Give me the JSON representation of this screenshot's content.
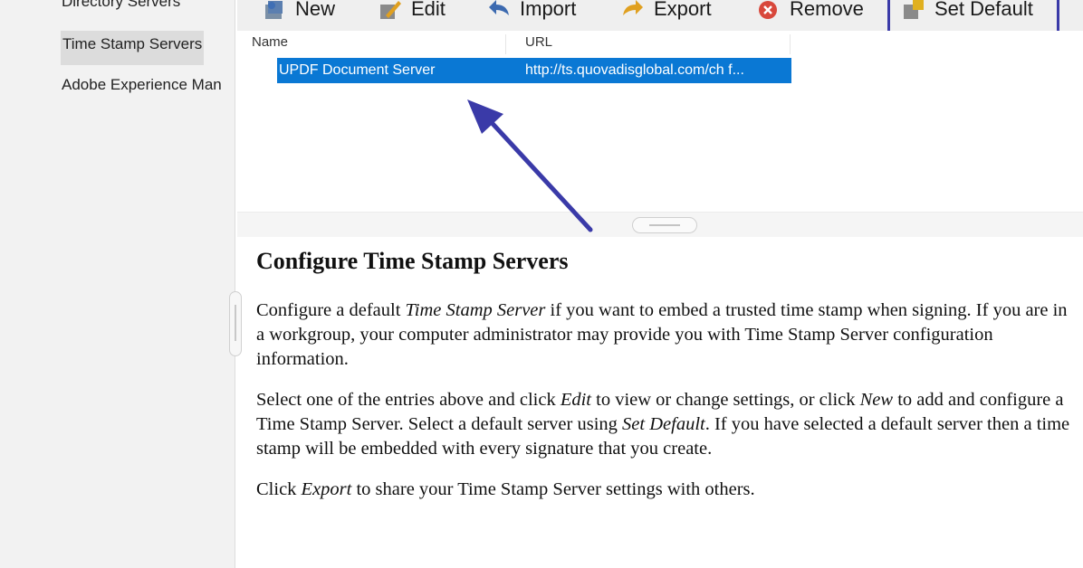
{
  "sidebar": {
    "items": [
      {
        "label": "Directory Servers"
      },
      {
        "label": "Time Stamp Servers"
      },
      {
        "label": "Adobe Experience Man"
      }
    ]
  },
  "toolbar": {
    "new_label": "New",
    "edit_label": "Edit",
    "import_label": "Import",
    "export_label": "Export",
    "remove_label": "Remove",
    "set_default_label": "Set Default"
  },
  "table": {
    "headers": [
      "Name",
      "URL"
    ],
    "rows": [
      {
        "name": "UPDF Document Server",
        "url": "http://ts.quovadisglobal.com/ch f..."
      }
    ]
  },
  "help": {
    "title": "Configure Time Stamp Servers",
    "p1_a": "Configure a default ",
    "p1_em": "Time Stamp Server",
    "p1_b": " if you want to embed a trusted time stamp when signing. If you are in a workgroup, your computer administrator may provide you with Time Stamp Server configuration information.",
    "p2_a": "Select one of the entries above and click ",
    "p2_em1": "Edit",
    "p2_b": " to view or change settings, or click ",
    "p2_em2": "New",
    "p2_c": " to add and configure a Time Stamp Server. Select a default server using ",
    "p2_em3": "Set Default",
    "p2_d": ". If you have selected a default server then a time stamp will be embedded with every signature that you create.",
    "p3_a": "Click ",
    "p3_em": "Export",
    "p3_b": " to share your Time Stamp Server settings with others."
  },
  "colors": {
    "selection": "#0a78d4",
    "annotation": "#3a3aa8"
  },
  "icons": [
    "new-icon",
    "edit-icon",
    "import-icon",
    "export-icon",
    "remove-icon",
    "set-default-icon"
  ]
}
